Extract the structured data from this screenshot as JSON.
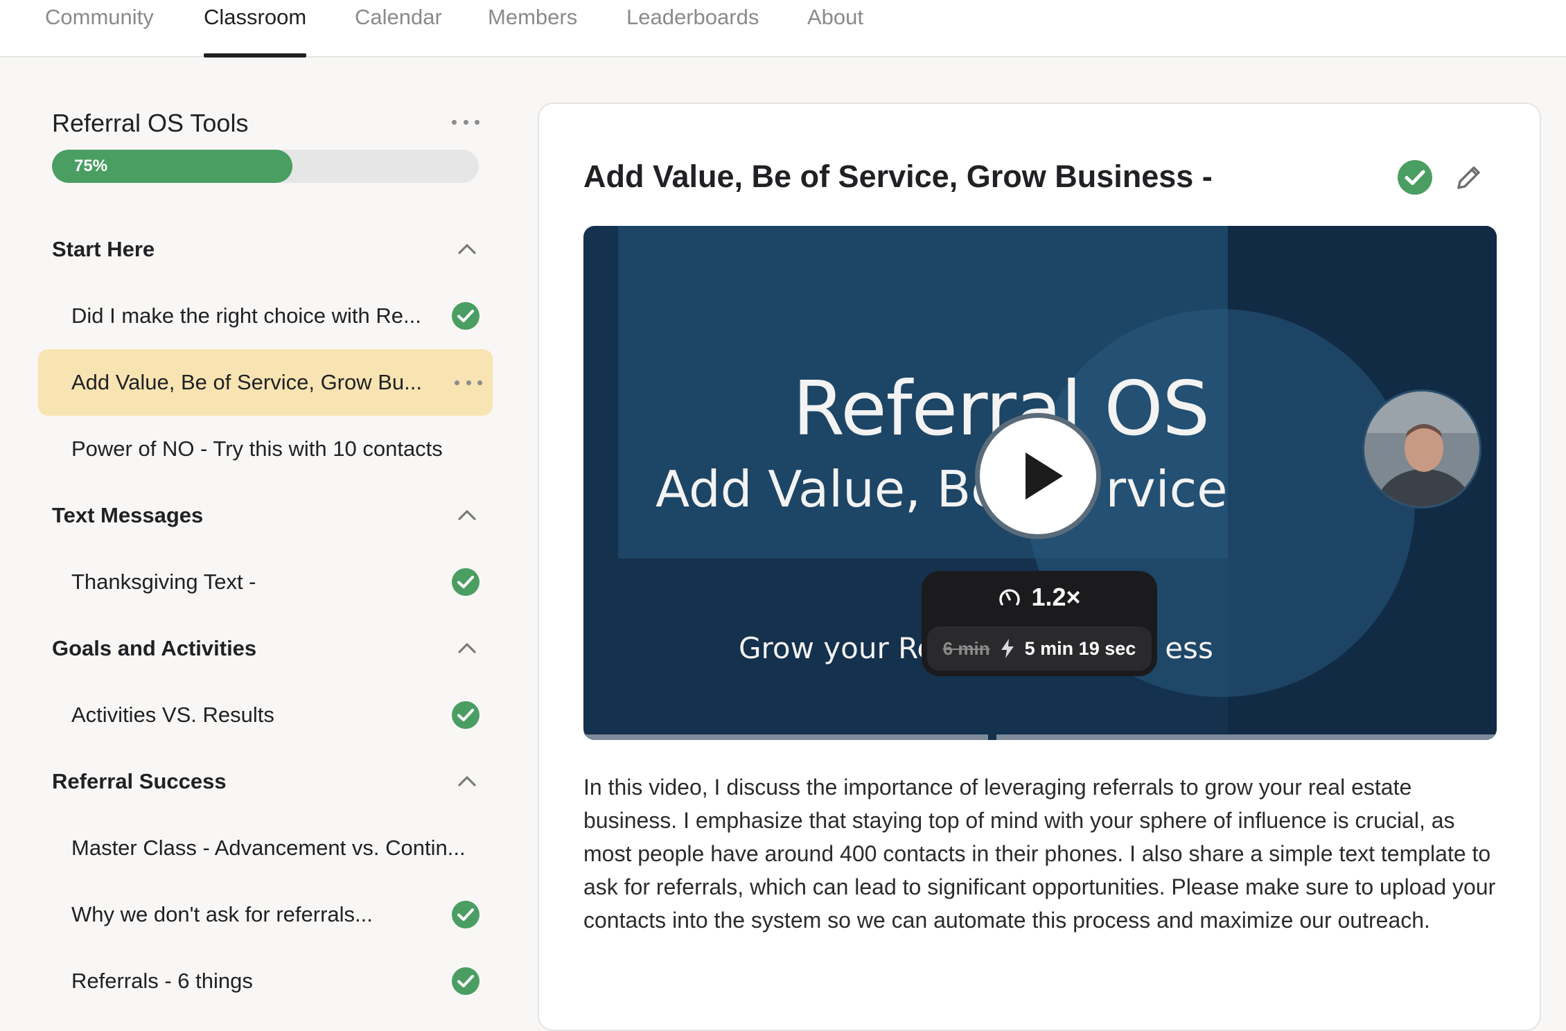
{
  "nav": {
    "tabs": [
      {
        "label": "Community"
      },
      {
        "label": "Classroom"
      },
      {
        "label": "Calendar"
      },
      {
        "label": "Members"
      },
      {
        "label": "Leaderboards"
      },
      {
        "label": "About"
      }
    ],
    "active_tab": "Classroom"
  },
  "sidebar": {
    "course_title": "Referral OS Tools",
    "progress": {
      "percent": 75,
      "label": "75%"
    },
    "sections": [
      {
        "title": "Start Here",
        "expanded": true,
        "lessons": [
          {
            "title": "Did I make the right choice with Re...",
            "completed": true
          },
          {
            "title": "Add Value, Be of Service, Grow Bu...",
            "active": true,
            "completed": false
          },
          {
            "title": "Power of NO - Try this with 10 contacts",
            "completed": false
          }
        ]
      },
      {
        "title": "Text Messages",
        "expanded": true,
        "lessons": [
          {
            "title": "Thanksgiving Text -",
            "completed": true
          }
        ]
      },
      {
        "title": "Goals and Activities",
        "expanded": true,
        "lessons": [
          {
            "title": "Activities VS. Results",
            "completed": true
          }
        ]
      },
      {
        "title": "Referral Success",
        "expanded": true,
        "lessons": [
          {
            "title": "Master Class - Advancement vs. Contin...",
            "completed": false
          },
          {
            "title": "Why we don't ask for referrals...",
            "completed": true
          },
          {
            "title": "Referrals - 6 things",
            "completed": true
          }
        ]
      }
    ]
  },
  "main": {
    "lesson_title": "Add Value, Be of Service, Grow Business -",
    "completed": true,
    "video": {
      "title_line1": "Referral OS",
      "title_line2": "Add Value, Be",
      "title_line2_tail": "rvice",
      "title_line3": "Grow your Re",
      "title_line3_tail": "ess",
      "speed": "1.2×",
      "original_duration": "6 min",
      "new_duration": "5 min 19 sec"
    },
    "description": "In this video, I discuss the importance of leveraging referrals to grow your real estate business. I emphasize that staying top of mind with your sphere of influence is crucial, as most people have around 400 contacts in their phones. I also share a simple text template to ask for referrals, which can lead to significant opportunities. Please make sure to upload your contacts into the system so we can automate this process and maximize our outreach."
  },
  "colors": {
    "accent_green": "#4a9e62",
    "active_lesson_bg": "#f8e4b2",
    "video_bg": "#14314d"
  },
  "icons": {
    "more": "more-dots-icon",
    "collapse": "chevron-up-icon",
    "complete": "check-circle-icon",
    "edit": "pencil-icon",
    "play": "play-icon",
    "speed": "speedometer-icon",
    "lightning": "lightning-icon"
  }
}
